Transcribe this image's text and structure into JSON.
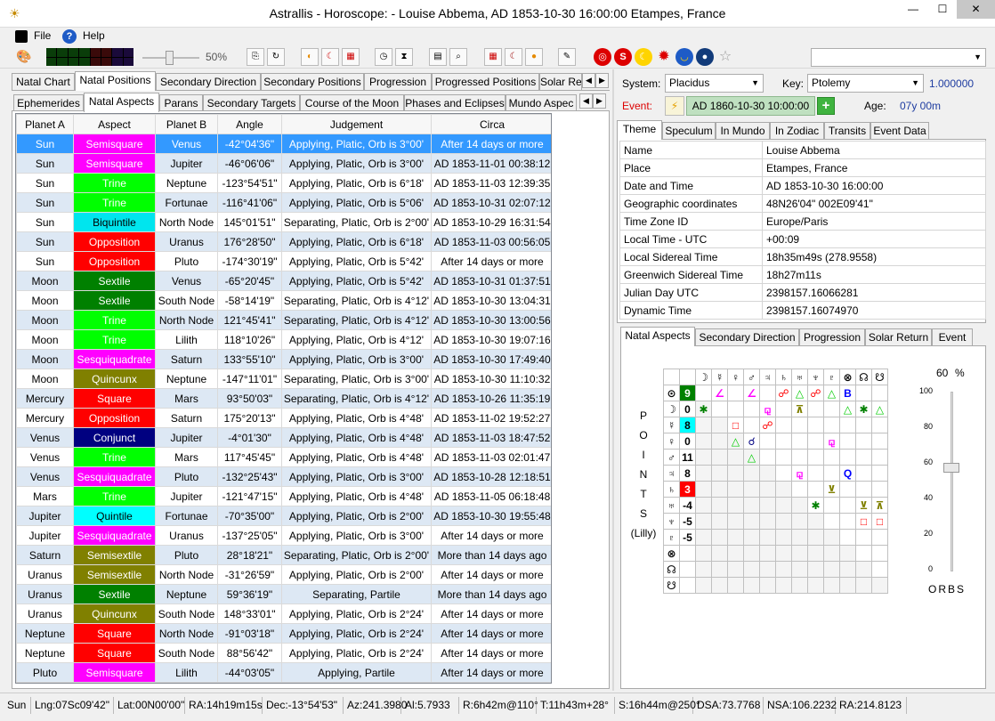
{
  "window": {
    "title": "Astrallis - Horoscope: - Louise Abbema, AD 1853-10-30 16:00:00 Etampes, France"
  },
  "menu": {
    "file": "File",
    "help": "Help"
  },
  "toolbar": {
    "zoom": "50%"
  },
  "main_tabs": [
    "Natal Chart",
    "Natal Positions",
    "Secondary Direction",
    "Secondary Positions",
    "Progression",
    "Progressed Positions",
    "Solar Re"
  ],
  "sub_tabs": [
    "Ephemerides",
    "Natal Aspects",
    "Parans",
    "Secondary Targets",
    "Course of the Moon",
    "Phases and Eclipses",
    "Mundo Aspec"
  ],
  "aspects_table": {
    "columns": [
      "Planet A",
      "Aspect",
      "Planet B",
      "Angle",
      "Judgement",
      "Circa"
    ],
    "rows": [
      {
        "a": "Sun",
        "aspect": "Semisquare",
        "color": "#ff00ff",
        "fg": "#fff",
        "b": "Venus",
        "angle": "-42°04'36\"",
        "judgement": "Applying, Platic, Orb is 3°00'",
        "circa": "After 14 days or more"
      },
      {
        "a": "Sun",
        "aspect": "Semisquare",
        "color": "#ff00ff",
        "fg": "#fff",
        "b": "Jupiter",
        "angle": "-46°06'06\"",
        "judgement": "Applying, Platic, Orb is 3°00'",
        "circa": "AD 1853-11-01 00:38:12"
      },
      {
        "a": "Sun",
        "aspect": "Trine",
        "color": "#00ff00",
        "fg": "#fff",
        "b": "Neptune",
        "angle": "-123°54'51\"",
        "judgement": "Applying, Platic, Orb is 6°18'",
        "circa": "AD 1853-11-03 12:39:35"
      },
      {
        "a": "Sun",
        "aspect": "Trine",
        "color": "#00ff00",
        "fg": "#fff",
        "b": "Fortunae",
        "angle": "-116°41'06\"",
        "judgement": "Applying, Platic, Orb is 5°06'",
        "circa": "AD 1853-10-31 02:07:12"
      },
      {
        "a": "Sun",
        "aspect": "Biquintile",
        "color": "#00e5ee",
        "fg": "#000",
        "b": "North Node",
        "angle": "145°01'51\"",
        "judgement": "Separating, Platic, Orb is 2°00'",
        "circa": "AD 1853-10-29 16:31:54"
      },
      {
        "a": "Sun",
        "aspect": "Opposition",
        "color": "#ff0000",
        "fg": "#fff",
        "b": "Uranus",
        "angle": "176°28'50\"",
        "judgement": "Applying, Platic, Orb is 6°18'",
        "circa": "AD 1853-11-03 00:56:05"
      },
      {
        "a": "Sun",
        "aspect": "Opposition",
        "color": "#ff0000",
        "fg": "#fff",
        "b": "Pluto",
        "angle": "-174°30'19\"",
        "judgement": "Applying, Platic, Orb is 5°42'",
        "circa": "After 14 days or more"
      },
      {
        "a": "Moon",
        "aspect": "Sextile",
        "color": "#008000",
        "fg": "#fff",
        "b": "Venus",
        "angle": "-65°20'45\"",
        "judgement": "Applying, Platic, Orb is 5°42'",
        "circa": "AD 1853-10-31 01:37:51"
      },
      {
        "a": "Moon",
        "aspect": "Sextile",
        "color": "#008000",
        "fg": "#fff",
        "b": "South Node",
        "angle": "-58°14'19\"",
        "judgement": "Separating, Platic, Orb is 4°12'",
        "circa": "AD 1853-10-30 13:04:31"
      },
      {
        "a": "Moon",
        "aspect": "Trine",
        "color": "#00ff00",
        "fg": "#fff",
        "b": "North Node",
        "angle": "121°45'41\"",
        "judgement": "Separating, Platic, Orb is 4°12'",
        "circa": "AD 1853-10-30 13:00:56"
      },
      {
        "a": "Moon",
        "aspect": "Trine",
        "color": "#00ff00",
        "fg": "#fff",
        "b": "Lilith",
        "angle": "118°10'26\"",
        "judgement": "Applying, Platic, Orb is 4°12'",
        "circa": "AD 1853-10-30 19:07:16"
      },
      {
        "a": "Moon",
        "aspect": "Sesquiquadrate",
        "color": "#ff00ff",
        "fg": "#fff",
        "b": "Saturn",
        "angle": "133°55'10\"",
        "judgement": "Applying, Platic, Orb is 3°00'",
        "circa": "AD 1853-10-30 17:49:40"
      },
      {
        "a": "Moon",
        "aspect": "Quincunx",
        "color": "#808000",
        "fg": "#fff",
        "b": "Neptune",
        "angle": "-147°11'01\"",
        "judgement": "Separating, Platic, Orb is 3°00'",
        "circa": "AD 1853-10-30 11:10:32"
      },
      {
        "a": "Mercury",
        "aspect": "Square",
        "color": "#ff0000",
        "fg": "#fff",
        "b": "Mars",
        "angle": "93°50'03\"",
        "judgement": "Separating, Platic, Orb is 4°12'",
        "circa": "AD 1853-10-26 11:35:19"
      },
      {
        "a": "Mercury",
        "aspect": "Opposition",
        "color": "#ff0000",
        "fg": "#fff",
        "b": "Saturn",
        "angle": "175°20'13\"",
        "judgement": "Applying, Platic, Orb is 4°48'",
        "circa": "AD 1853-11-02 19:52:27"
      },
      {
        "a": "Venus",
        "aspect": "Conjunct",
        "color": "#000080",
        "fg": "#fff",
        "b": "Jupiter",
        "angle": "-4°01'30\"",
        "judgement": "Applying, Platic, Orb is 4°48'",
        "circa": "AD 1853-11-03 18:47:52"
      },
      {
        "a": "Venus",
        "aspect": "Trine",
        "color": "#00ff00",
        "fg": "#fff",
        "b": "Mars",
        "angle": "117°45'45\"",
        "judgement": "Applying, Platic, Orb is 4°48'",
        "circa": "AD 1853-11-03 02:01:47"
      },
      {
        "a": "Venus",
        "aspect": "Sesquiquadrate",
        "color": "#ff00ff",
        "fg": "#fff",
        "b": "Pluto",
        "angle": "-132°25'43\"",
        "judgement": "Applying, Platic, Orb is 3°00'",
        "circa": "AD 1853-10-28 12:18:51"
      },
      {
        "a": "Mars",
        "aspect": "Trine",
        "color": "#00ff00",
        "fg": "#fff",
        "b": "Jupiter",
        "angle": "-121°47'15\"",
        "judgement": "Applying, Platic, Orb is 4°48'",
        "circa": "AD 1853-11-05 06:18:48"
      },
      {
        "a": "Jupiter",
        "aspect": "Quintile",
        "color": "#00ffff",
        "fg": "#000",
        "b": "Fortunae",
        "angle": "-70°35'00\"",
        "judgement": "Applying, Platic, Orb is 2°00'",
        "circa": "AD 1853-10-30 19:55:48"
      },
      {
        "a": "Jupiter",
        "aspect": "Sesquiquadrate",
        "color": "#ff00ff",
        "fg": "#fff",
        "b": "Uranus",
        "angle": "-137°25'05\"",
        "judgement": "Applying, Platic, Orb is 3°00'",
        "circa": "After 14 days or more"
      },
      {
        "a": "Saturn",
        "aspect": "Semisextile",
        "color": "#808000",
        "fg": "#fff",
        "b": "Pluto",
        "angle": "28°18'21\"",
        "judgement": "Separating, Platic, Orb is 2°00'",
        "circa": "More than 14 days ago"
      },
      {
        "a": "Uranus",
        "aspect": "Semisextile",
        "color": "#808000",
        "fg": "#fff",
        "b": "North Node",
        "angle": "-31°26'59\"",
        "judgement": "Applying, Platic, Orb is 2°00'",
        "circa": "After 14 days or more"
      },
      {
        "a": "Uranus",
        "aspect": "Sextile",
        "color": "#008000",
        "fg": "#fff",
        "b": "Neptune",
        "angle": "59°36'19\"",
        "judgement": "Separating, Partile",
        "circa": "More than 14 days ago"
      },
      {
        "a": "Uranus",
        "aspect": "Quincunx",
        "color": "#808000",
        "fg": "#fff",
        "b": "South Node",
        "angle": "148°33'01\"",
        "judgement": "Applying, Platic, Orb is 2°24'",
        "circa": "After 14 days or more"
      },
      {
        "a": "Neptune",
        "aspect": "Square",
        "color": "#ff0000",
        "fg": "#fff",
        "b": "North Node",
        "angle": "-91°03'18\"",
        "judgement": "Applying, Platic, Orb is 2°24'",
        "circa": "After 14 days or more"
      },
      {
        "a": "Neptune",
        "aspect": "Square",
        "color": "#ff0000",
        "fg": "#fff",
        "b": "South Node",
        "angle": "88°56'42\"",
        "judgement": "Applying, Platic, Orb is 2°24'",
        "circa": "After 14 days or more"
      },
      {
        "a": "Pluto",
        "aspect": "Semisquare",
        "color": "#ff00ff",
        "fg": "#fff",
        "b": "Lilith",
        "angle": "-44°03'05\"",
        "judgement": "Applying, Partile",
        "circa": "After 14 days or more"
      }
    ]
  },
  "right_panel": {
    "system_label": "System:",
    "system_value": "Placidus",
    "key_label": "Key:",
    "key_value": "Ptolemy",
    "key_number": "1.000000",
    "event_label": "Event:",
    "event_value": "AD 1860-10-30 10:00:00",
    "age_label": "Age:",
    "age_value": "07y 00m",
    "tabs": [
      "Theme",
      "Speculum",
      "In Mundo",
      "In Zodiac",
      "Transits",
      "Event Data"
    ],
    "details": [
      {
        "k": "Name",
        "v": "Louise Abbema"
      },
      {
        "k": "Place",
        "v": "Etampes, France"
      },
      {
        "k": "Date and Time",
        "v": "AD 1853-10-30 16:00:00"
      },
      {
        "k": "Geographic coordinates",
        "v": "48N26'04\" 002E09'41\""
      },
      {
        "k": "Time Zone ID",
        "v": "Europe/Paris"
      },
      {
        "k": "Local Time - UTC",
        "v": "+00:09"
      },
      {
        "k": "Local Sidereal Time",
        "v": "18h35m49s (278.9558)"
      },
      {
        "k": "Greenwich Sidereal Time",
        "v": "18h27m11s"
      },
      {
        "k": "Julian Day UTC",
        "v": "2398157.16066281"
      },
      {
        "k": "Dynamic Time",
        "v": "2398157.16074970"
      }
    ],
    "lower_tabs": [
      "Natal Aspects",
      "Secondary Direction",
      "Progression",
      "Solar Return",
      "Event"
    ],
    "points_label": [
      "P",
      "O",
      "I",
      "N",
      "T",
      "S",
      "(Lilly)"
    ],
    "orbs": {
      "value": "60",
      "unit": "%",
      "ticks": [
        "100",
        "80",
        "60",
        "40",
        "20",
        "0"
      ],
      "label": "ORBS",
      "level": 60
    },
    "grid": {
      "glyphs": [
        "☽",
        "☿",
        "♀",
        "♂",
        "♃",
        "♄",
        "♅",
        "♆",
        "♇",
        "⊗",
        "☊",
        "☋"
      ],
      "rows": [
        {
          "g": "⊙",
          "n": "9",
          "bg": "#008000",
          "fg": "#fff"
        },
        {
          "g": "☽",
          "n": "0",
          "bg": "#fff",
          "fg": "#000"
        },
        {
          "g": "☿",
          "n": "8",
          "bg": "#00ffff",
          "fg": "#000"
        },
        {
          "g": "♀",
          "n": "0",
          "bg": "#fff",
          "fg": "#000"
        },
        {
          "g": "♂",
          "n": "11",
          "bg": "#fff",
          "fg": "#000"
        },
        {
          "g": "♃",
          "n": "8",
          "bg": "#fff",
          "fg": "#000"
        },
        {
          "g": "♄",
          "n": "3",
          "bg": "#ff0000",
          "fg": "#fff"
        },
        {
          "g": "♅",
          "n": "-4",
          "bg": "#fff",
          "fg": "#000"
        },
        {
          "g": "♆",
          "n": "-5",
          "bg": "#fff",
          "fg": "#000"
        },
        {
          "g": "♇",
          "n": "-5",
          "bg": "#fff",
          "fg": "#000"
        },
        {
          "g": "⊗",
          "n": "",
          "bg": "#fff",
          "fg": "#000"
        },
        {
          "g": "☊",
          "n": "",
          "bg": "#fff",
          "fg": "#000"
        },
        {
          "g": "☋",
          "n": "",
          "bg": "#fff",
          "fg": "#000"
        }
      ],
      "cells": [
        {
          "r": 0,
          "c": 2,
          "s": "∠",
          "col": "#ff00ff"
        },
        {
          "r": 0,
          "c": 4,
          "s": "∠",
          "col": "#ff00ff"
        },
        {
          "r": 0,
          "c": 6,
          "s": "☍",
          "col": "#ff0000"
        },
        {
          "r": 0,
          "c": 7,
          "s": "△",
          "col": "#00cc00"
        },
        {
          "r": 0,
          "c": 8,
          "s": "☍",
          "col": "#ff0000"
        },
        {
          "r": 0,
          "c": 9,
          "s": "△",
          "col": "#00cc00"
        },
        {
          "r": 0,
          "c": 10,
          "s": "B",
          "col": "#0000ff"
        },
        {
          "r": 1,
          "c": 1,
          "s": "✱",
          "col": "#008000"
        },
        {
          "r": 1,
          "c": 5,
          "s": "⚼",
          "col": "#ff00ff"
        },
        {
          "r": 1,
          "c": 7,
          "s": "⊼",
          "col": "#808000"
        },
        {
          "r": 1,
          "c": 10,
          "s": "△",
          "col": "#00cc00"
        },
        {
          "r": 1,
          "c": 11,
          "s": "✱",
          "col": "#008000"
        },
        {
          "r": 1,
          "c": 12,
          "s": "△",
          "col": "#00cc00"
        },
        {
          "r": 2,
          "c": 3,
          "s": "□",
          "col": "#ff0000"
        },
        {
          "r": 2,
          "c": 5,
          "s": "☍",
          "col": "#ff0000"
        },
        {
          "r": 3,
          "c": 3,
          "s": "△",
          "col": "#00cc00"
        },
        {
          "r": 3,
          "c": 4,
          "s": "☌",
          "col": "#000080"
        },
        {
          "r": 3,
          "c": 9,
          "s": "⚼",
          "col": "#ff00ff"
        },
        {
          "r": 4,
          "c": 4,
          "s": "△",
          "col": "#00cc00"
        },
        {
          "r": 5,
          "c": 7,
          "s": "⚼",
          "col": "#ff00ff"
        },
        {
          "r": 5,
          "c": 10,
          "s": "Q",
          "col": "#0000ff"
        },
        {
          "r": 6,
          "c": 9,
          "s": "⊻",
          "col": "#808000"
        },
        {
          "r": 7,
          "c": 8,
          "s": "✱",
          "col": "#008000"
        },
        {
          "r": 7,
          "c": 11,
          "s": "⊻",
          "col": "#808000"
        },
        {
          "r": 7,
          "c": 12,
          "s": "⊼",
          "col": "#808000"
        },
        {
          "r": 8,
          "c": 11,
          "s": "□",
          "col": "#ff0000"
        },
        {
          "r": 8,
          "c": 12,
          "s": "□",
          "col": "#ff0000"
        },
        {
          "r": 9,
          "c": 13,
          "s": "∠",
          "col": "#ff00ff"
        }
      ]
    }
  },
  "status": [
    "Sun",
    "Lng:07Sc09'42\"",
    "Lat:00N00'00\"",
    "RA:14h19m15s",
    "Dec:-13°54'53\"",
    "Az:241.3980",
    "Al:5.7933",
    "R:6h42m@110°",
    "T:11h43m+28°",
    "S:16h44m@250°",
    "DSA:73.7768",
    "NSA:106.2232",
    "RA:214.8123"
  ]
}
